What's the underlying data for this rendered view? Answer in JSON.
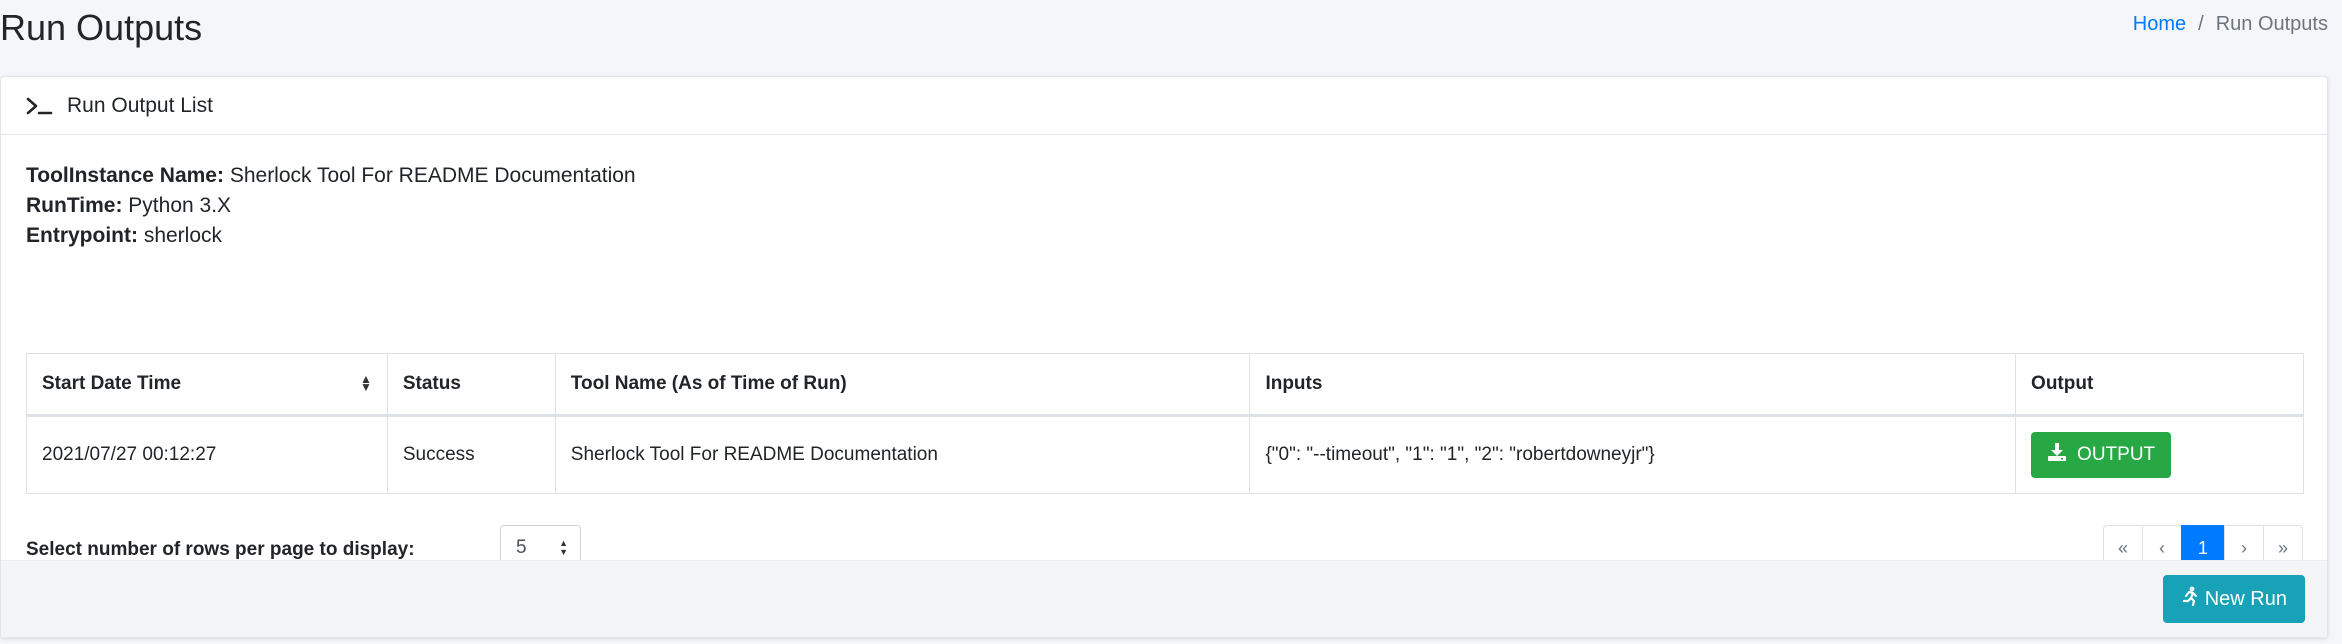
{
  "page": {
    "title": "Run Outputs"
  },
  "breadcrumb": {
    "home": "Home",
    "separator": "/",
    "current": "Run Outputs"
  },
  "card": {
    "header_title": "Run Output List",
    "header_icon": "terminal-icon",
    "meta": {
      "toolinstance_label": "ToolInstance Name:",
      "toolinstance_value": "Sherlock Tool For README Documentation",
      "runtime_label": "RunTime:",
      "runtime_value": "Python 3.X",
      "entrypoint_label": "Entrypoint:",
      "entrypoint_value": "sherlock"
    },
    "table": {
      "columns": [
        "Start Date Time",
        "Status",
        "Tool Name (As of Time of Run)",
        "Inputs",
        "Output"
      ],
      "rows": [
        {
          "start": "2021/07/27 00:12:27",
          "status": "Success",
          "tool_name": "Sherlock Tool For README Documentation",
          "inputs": "{\"0\": \"--timeout\", \"1\": \"1\", \"2\": \"robertdowneyjr\"}",
          "output_button": "OUTPUT"
        }
      ]
    },
    "rows_per_page": {
      "label": "Select number of rows per page to display:",
      "value": "5"
    },
    "pagination": {
      "first": "«",
      "prev": "‹",
      "current": "1",
      "next": "›",
      "last": "»"
    },
    "footer": {
      "new_run_label": "New Run"
    }
  },
  "colors": {
    "primary": "#007bff",
    "success": "#28a745",
    "info": "#17a2b8",
    "background": "#f4f6f9"
  }
}
